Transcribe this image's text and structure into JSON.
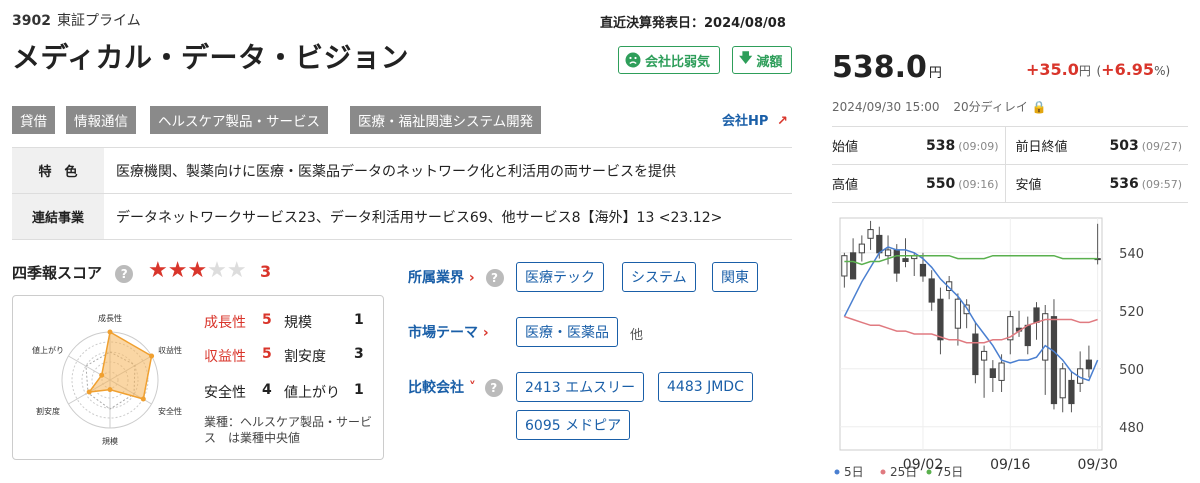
{
  "stock": {
    "code": "3902",
    "market": "東証プライム",
    "name": "メディカル・データ・ビジョン",
    "settlement": "直近決算発表日：2024/08/08",
    "weak_badge": "会社比弱気",
    "reduce_badge": "減額"
  },
  "tags": [
    "貸借",
    "情報通信",
    "ヘルスケア製品・サービス",
    "医療・福祉関連システム開発"
  ],
  "company_hp": "会社HP",
  "info": {
    "feature_label": "特　色",
    "feature": "医療機関、製薬向けに医療・医薬品データのネットワーク化と利活用の両サービスを提供",
    "segment_label": "連結事業",
    "segment": "データネットワークサービス23、データ利活用サービス69、他サービス8【海外】13 <23.12>"
  },
  "score": {
    "title": "四季報スコア",
    "help": "?",
    "stars_filled": "★★★",
    "stars_empty": "★★",
    "value": "3",
    "radar_labels": [
      "成長性",
      "収益性",
      "安全性",
      "規模",
      "割安度",
      "値上がり"
    ],
    "items": [
      {
        "label": "成長性",
        "value": "5",
        "highlight": true
      },
      {
        "label": "規模",
        "value": "1"
      },
      {
        "label": "収益性",
        "value": "5",
        "highlight": true
      },
      {
        "label": "割安度",
        "value": "3"
      },
      {
        "label": "安全性",
        "value": "4"
      },
      {
        "label": "値上がり",
        "value": "1"
      }
    ],
    "note": "業種：ヘルスケア製品・サービス　は業種中央値"
  },
  "industry": {
    "label": "所属業界",
    "chips": [
      "医療テック",
      "システム",
      "関東"
    ]
  },
  "theme": {
    "label": "市場テーマ",
    "chips": [
      "医療・医薬品"
    ],
    "more": "他"
  },
  "compare": {
    "label": "比較会社",
    "chips": [
      "2413 エムスリー",
      "4483 JMDC",
      "6095 メドピア"
    ]
  },
  "quote": {
    "price": "538.0",
    "unit": "円",
    "change": "+35.0",
    "change_unit": "円",
    "change_pct": "+6.95",
    "pct_unit": "%",
    "time": "2024/09/30 15:00",
    "delay": "20分ディレイ",
    "open_label": "始値",
    "open": "538",
    "open_time": "(09:09)",
    "prev_label": "前日終値",
    "prev": "503",
    "prev_time": "(09/27)",
    "high_label": "高値",
    "high": "550",
    "high_time": "(09:16)",
    "low_label": "安値",
    "low": "536",
    "low_time": "(09:57)"
  },
  "colors": {
    "up": "#d9352b",
    "link": "#1a5fa8",
    "green": "#2e9e5a"
  },
  "chart_data": {
    "type": "candlestick",
    "ylim": [
      472,
      552
    ],
    "yticks": [
      480,
      500,
      520,
      540
    ],
    "xticks": [
      "09/02",
      "09/16",
      "09/30"
    ],
    "legend": [
      "5日",
      "25日",
      "75日"
    ],
    "candles": [
      {
        "o": 532,
        "h": 540,
        "l": 528,
        "c": 539
      },
      {
        "o": 540,
        "h": 545,
        "l": 534,
        "c": 531
      },
      {
        "o": 540,
        "h": 546,
        "l": 537,
        "c": 543
      },
      {
        "o": 545,
        "h": 551,
        "l": 541,
        "c": 548
      },
      {
        "o": 546,
        "h": 549,
        "l": 538,
        "c": 540
      },
      {
        "o": 539,
        "h": 546,
        "l": 536,
        "c": 541
      },
      {
        "o": 541,
        "h": 543,
        "l": 530,
        "c": 533
      },
      {
        "o": 538,
        "h": 545,
        "l": 535,
        "c": 537
      },
      {
        "o": 538,
        "h": 540,
        "l": 532,
        "c": 539
      },
      {
        "o": 536,
        "h": 540,
        "l": 530,
        "c": 532
      },
      {
        "o": 531,
        "h": 534,
        "l": 520,
        "c": 523
      },
      {
        "o": 524,
        "h": 528,
        "l": 505,
        "c": 510
      },
      {
        "o": 527,
        "h": 532,
        "l": 524,
        "c": 530
      },
      {
        "o": 514,
        "h": 526,
        "l": 508,
        "c": 524
      },
      {
        "o": 519,
        "h": 524,
        "l": 514,
        "c": 522
      },
      {
        "o": 512,
        "h": 516,
        "l": 495,
        "c": 498
      },
      {
        "o": 503,
        "h": 508,
        "l": 490,
        "c": 506
      },
      {
        "o": 500,
        "h": 503,
        "l": 492,
        "c": 497
      },
      {
        "o": 496,
        "h": 505,
        "l": 492,
        "c": 502
      },
      {
        "o": 510,
        "h": 520,
        "l": 505,
        "c": 518
      },
      {
        "o": 514,
        "h": 520,
        "l": 511,
        "c": 513
      },
      {
        "o": 515,
        "h": 518,
        "l": 505,
        "c": 508
      },
      {
        "o": 521,
        "h": 523,
        "l": 510,
        "c": 516
      },
      {
        "o": 503,
        "h": 522,
        "l": 491,
        "c": 519
      },
      {
        "o": 518,
        "h": 524,
        "l": 486,
        "c": 488
      },
      {
        "o": 490,
        "h": 502,
        "l": 485,
        "c": 500
      },
      {
        "o": 496,
        "h": 499,
        "l": 485,
        "c": 488
      },
      {
        "o": 495,
        "h": 506,
        "l": 492,
        "c": 500
      },
      {
        "o": 503,
        "h": 508,
        "l": 497,
        "c": 500
      },
      {
        "o": 538,
        "h": 550,
        "l": 536,
        "c": 538
      }
    ],
    "series": [
      {
        "name": "5日",
        "color": "#4a7fd0",
        "values": [
          518,
          524,
          530,
          535,
          540,
          542,
          541,
          541,
          540,
          538,
          535,
          531,
          528,
          525,
          521,
          516,
          512,
          508,
          503,
          502,
          503,
          503,
          504,
          508,
          506,
          503,
          499,
          497,
          496,
          503
        ]
      },
      {
        "name": "25日",
        "color": "#e07a80",
        "values": [
          518,
          517,
          516,
          515,
          515,
          514,
          513,
          513,
          512,
          512,
          512,
          511,
          510,
          510,
          509,
          509,
          509,
          510,
          510,
          511,
          513,
          515,
          516,
          517,
          517,
          517,
          517,
          516,
          516,
          517
        ]
      },
      {
        "name": "75日",
        "color": "#5ab04e",
        "values": [
          537,
          537,
          536,
          537,
          537,
          538,
          539,
          539,
          539,
          539,
          539,
          539,
          539,
          538,
          538,
          538,
          538,
          539,
          539,
          539,
          539,
          539,
          539,
          539,
          539,
          538,
          538,
          538,
          538,
          538
        ]
      }
    ]
  }
}
